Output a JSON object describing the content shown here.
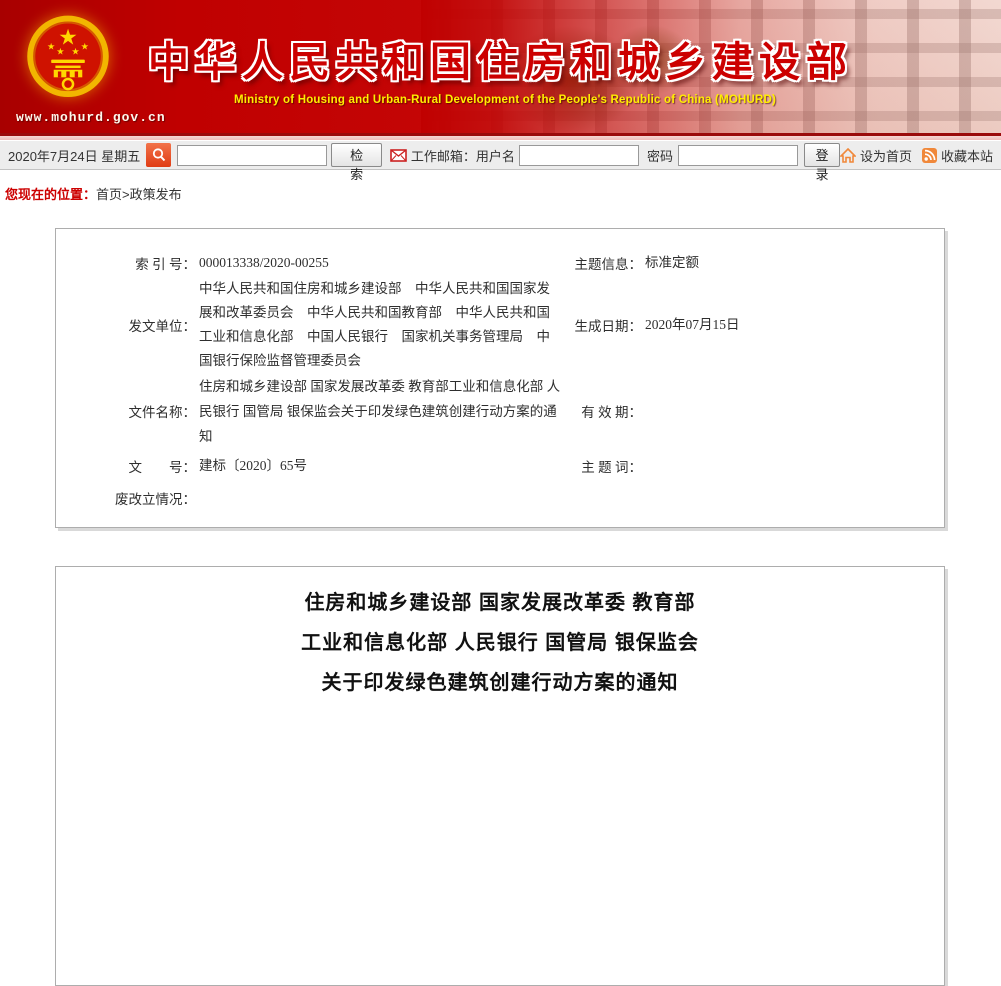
{
  "header": {
    "site_url": "www.mohurd.gov.cn",
    "title": "中华人民共和国住房和城乡建设部",
    "subtitle": "Ministry of Housing and Urban-Rural Development of the People's Republic of China (MOHURD)"
  },
  "toolbar": {
    "date": "2020年7月24日 星期五",
    "search_button_label": "检　索",
    "mail_label": "工作邮箱：用户名",
    "password_label": "密码",
    "login_button_label": "登录",
    "set_home_label": "设为首页",
    "favorite_label": "收藏本站"
  },
  "breadcrumb": {
    "prefix": "您现在的位置：",
    "path": "首页>政策发布"
  },
  "meta": {
    "index_label": "索 引 号：",
    "index_value": "000013338/2020-00255",
    "topic_label": "主题信息：",
    "topic_value": "标准定额",
    "issuer_label": "发文单位：",
    "issuer_value": "中华人民共和国住房和城乡建设部　中华人民共和国国家发展和改革委员会　中华人民共和国教育部　中华人民共和国工业和信息化部　中国人民银行　国家机关事务管理局　中国银行保险监督管理委员会",
    "gen_date_label": "生成日期：",
    "gen_date_value": "2020年07月15日",
    "docname_label": "文件名称：",
    "docname_value": "住房和城乡建设部 国家发展改革委 教育部工业和信息化部 人民银行 国管局 银保监会关于印发绿色建筑创建行动方案的通知",
    "validity_label": "有 效 期：",
    "validity_value": "",
    "docnum_label": "文　　号：",
    "docnum_value": "建标〔2020〕65号",
    "keyword_label": "主 题 词：",
    "keyword_value": "",
    "status_label": "废改立情况：",
    "status_value": ""
  },
  "doc_title": {
    "lines": [
      "住房和城乡建设部 国家发展改革委 教育部",
      "工业和信息化部 人民银行 国管局 银保监会",
      "关于印发绿色建筑创建行动方案的通知"
    ]
  },
  "icons": {
    "emblem": "china-national-emblem-icon",
    "search": "magnifier-icon",
    "mail": "envelope-icon",
    "home": "home-icon",
    "favorite": "rss-icon"
  },
  "colors": {
    "header_red": "#c00000",
    "title_red": "#cc0000",
    "subtitle_yellow": "#ffee00",
    "breadcrumb_red": "#cc0000",
    "search_button_red": "#e03c14",
    "icon_orange": "#f0883a",
    "toolbar_gray": "#ededed",
    "box_border_gray": "#adadad"
  }
}
